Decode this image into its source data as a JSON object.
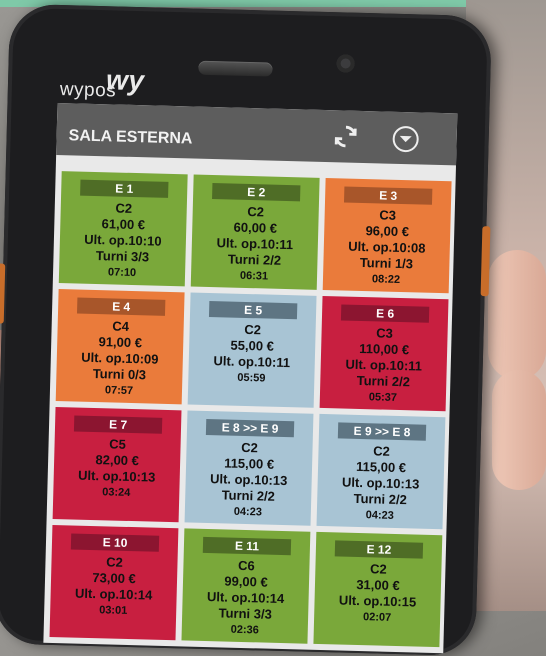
{
  "brand": {
    "logo_text": "wypos",
    "logo_mark": "wy"
  },
  "header": {
    "title": "SALA ESTERNA",
    "sync_icon": "sync-icon",
    "menu_icon": "dropdown-icon"
  },
  "colors": {
    "green": "#7aa83a",
    "orange": "#ea7b3b",
    "blue": "#a8c4d4",
    "red": "#c81f40"
  },
  "tables": [
    {
      "name": "E 1",
      "code": "C2",
      "amount": "61,00 €",
      "last_op": "Ult. op.10:10",
      "turns": "Turni 3/3",
      "time": "07:10",
      "color": "green"
    },
    {
      "name": "E 2",
      "code": "C2",
      "amount": "60,00 €",
      "last_op": "Ult. op.10:11",
      "turns": "Turni 2/2",
      "time": "06:31",
      "color": "green"
    },
    {
      "name": "E 3",
      "code": "C3",
      "amount": "96,00 €",
      "last_op": "Ult. op.10:08",
      "turns": "Turni 1/3",
      "time": "08:22",
      "color": "orange"
    },
    {
      "name": "E 4",
      "code": "C4",
      "amount": "91,00 €",
      "last_op": "Ult. op.10:09",
      "turns": "Turni 0/3",
      "time": "07:57",
      "color": "orange"
    },
    {
      "name": "E 5",
      "code": "C2",
      "amount": "55,00 €",
      "last_op": "Ult. op.10:11",
      "turns": "",
      "time": "05:59",
      "color": "blue"
    },
    {
      "name": "E 6",
      "code": "C3",
      "amount": "110,00 €",
      "last_op": "Ult. op.10:11",
      "turns": "Turni 2/2",
      "time": "05:37",
      "color": "red"
    },
    {
      "name": "E 7",
      "code": "C5",
      "amount": "82,00 €",
      "last_op": "Ult. op.10:13",
      "turns": "",
      "time": "03:24",
      "color": "red"
    },
    {
      "name": "E 8 >> E 9",
      "code": "C2",
      "amount": "115,00 €",
      "last_op": "Ult. op.10:13",
      "turns": "Turni 2/2",
      "time": "04:23",
      "color": "blue"
    },
    {
      "name": "E 9 >> E 8",
      "code": "C2",
      "amount": "115,00 €",
      "last_op": "Ult. op.10:13",
      "turns": "Turni 2/2",
      "time": "04:23",
      "color": "blue"
    },
    {
      "name": "E 10",
      "code": "C2",
      "amount": "73,00 €",
      "last_op": "Ult. op.10:14",
      "turns": "",
      "time": "03:01",
      "color": "red"
    },
    {
      "name": "E 11",
      "code": "C6",
      "amount": "99,00 €",
      "last_op": "Ult. op.10:14",
      "turns": "Turni 3/3",
      "time": "02:36",
      "color": "green"
    },
    {
      "name": "E 12",
      "code": "C2",
      "amount": "31,00 €",
      "last_op": "Ult. op.10:15",
      "turns": "",
      "time": "02:07",
      "color": "green"
    }
  ]
}
